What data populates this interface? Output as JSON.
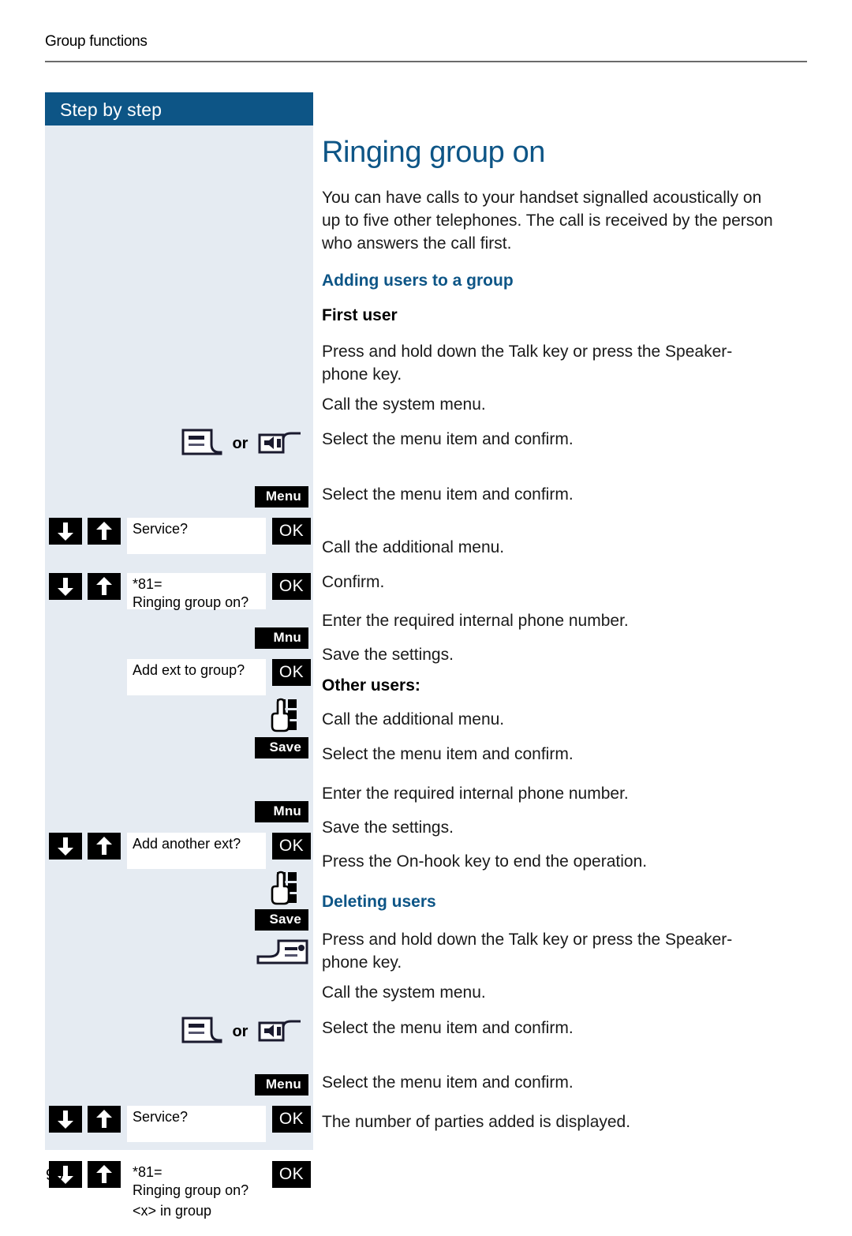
{
  "page": {
    "running_head": "Group functions",
    "number": "90"
  },
  "sidebar": {
    "header": "Step by step"
  },
  "doc": {
    "title": "Ringing group on",
    "intro": "You can have calls to your handset signalled acoustically on up to five other telephones. The call is received by the person who answers the call first.",
    "heading_adding": "Adding users to a group",
    "heading_first_user": "First user",
    "heading_other_users": "Other users:",
    "heading_deleting": "Deleting users"
  },
  "labels": {
    "or": "or",
    "menu": "Menu",
    "mnu": "Mnu",
    "save": "Save",
    "ok": "OK"
  },
  "steps": [
    {
      "id": "talk-or-speaker-1",
      "text": "Press and hold down the Talk key or press the Speaker-phone key."
    },
    {
      "id": "call-system-menu-1",
      "text": "Call the system menu."
    },
    {
      "id": "select-service-1",
      "display": [
        "Service?"
      ],
      "text": "Select the menu item and confirm."
    },
    {
      "id": "select-ringing-group-on-1",
      "display": [
        "*81=",
        "Ringing group on?"
      ],
      "text": "Select the menu item and confirm."
    },
    {
      "id": "call-additional-menu-1",
      "text": "Call the additional menu."
    },
    {
      "id": "add-ext-to-group",
      "display": [
        "Add ext to group?"
      ],
      "text": "Confirm."
    },
    {
      "id": "enter-number-1",
      "text": "Enter the required internal phone number."
    },
    {
      "id": "save-1",
      "text": "Save the settings."
    },
    {
      "id": "call-additional-menu-2",
      "text": "Call the additional menu."
    },
    {
      "id": "add-another-ext",
      "display": [
        "Add another ext?"
      ],
      "text": "Select the menu item and confirm."
    },
    {
      "id": "enter-number-2",
      "text": "Enter the required internal phone number."
    },
    {
      "id": "save-2",
      "text": "Save the settings."
    },
    {
      "id": "on-hook",
      "text": "Press the On-hook key to end the operation."
    },
    {
      "id": "talk-or-speaker-2",
      "text": "Press and hold down the Talk key or press the Speaker-phone key."
    },
    {
      "id": "call-system-menu-2",
      "text": "Call the system menu."
    },
    {
      "id": "select-service-2",
      "display": [
        "Service?"
      ],
      "text": "Select the menu item and confirm."
    },
    {
      "id": "select-ringing-group-on-2",
      "display": [
        "*81=",
        "Ringing group on?"
      ],
      "text": "Select the menu item and confirm."
    },
    {
      "id": "x-in-group",
      "display": [
        "<x> in group"
      ],
      "text": "The number of parties added is displayed."
    }
  ],
  "colors": {
    "brand_blue": "#0d5586",
    "sidebar_bg": "#e5ebf2",
    "key_black": "#000000"
  },
  "icons": {
    "talk_key": "talk-key-icon",
    "speakerphone_key": "speakerphone-key-icon",
    "on_hook_key": "on-hook-key-icon",
    "keypad": "keypad-hand-icon",
    "arrow_down": "arrow-down-icon",
    "arrow_up": "arrow-up-icon"
  }
}
